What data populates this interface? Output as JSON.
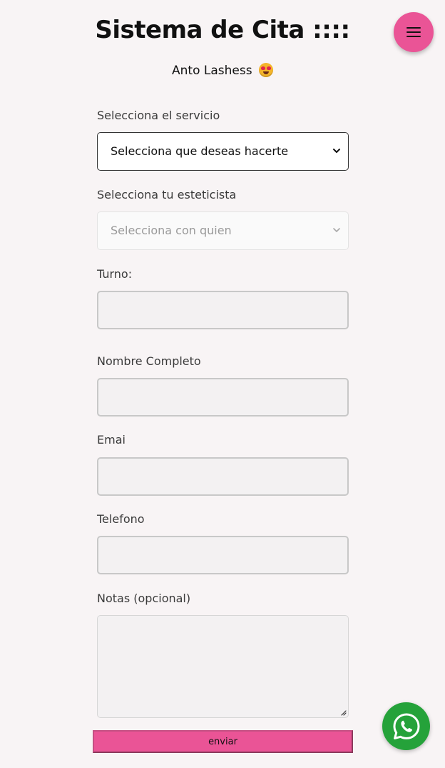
{
  "header": {
    "title": "Sistema de Cita ::::",
    "subtitle": "Anto Lashess",
    "subtitle_emoji": "star-struck-emoji"
  },
  "menu": {
    "icon": "hamburger-menu-icon",
    "color": "#ea5496"
  },
  "form": {
    "service": {
      "label": "Selecciona el servicio",
      "selected": "Selecciona que deseas hacerte"
    },
    "esthetician": {
      "label": "Selecciona tu esteticista",
      "selected": "Selecciona con quien"
    },
    "turno": {
      "label": "Turno:",
      "value": ""
    },
    "nombre": {
      "label": "Nombre Completo",
      "value": ""
    },
    "email": {
      "label": "Emai",
      "value": ""
    },
    "telefono": {
      "label": "Telefono",
      "value": ""
    },
    "notas": {
      "label": "Notas (opcional)",
      "value": ""
    },
    "submit_label": "enviar"
  },
  "whatsapp": {
    "icon": "whatsapp-icon",
    "color": "#25a23a"
  }
}
